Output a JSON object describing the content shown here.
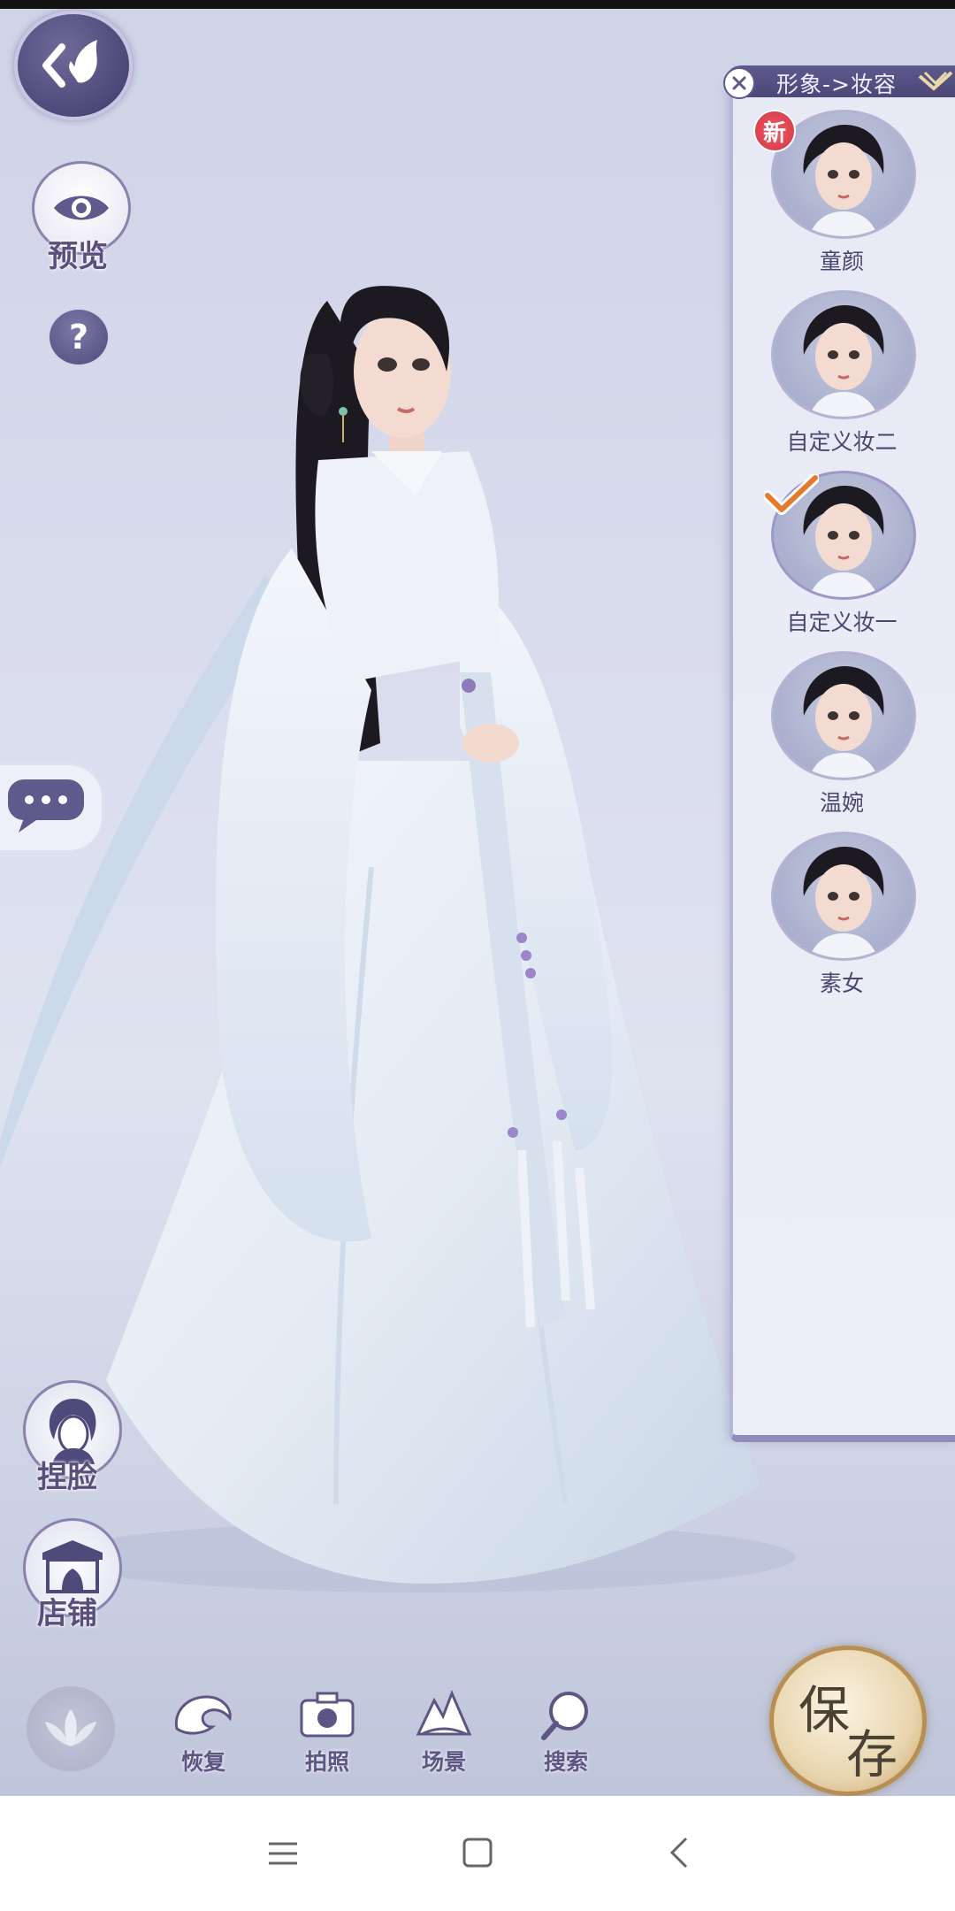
{
  "top": {
    "preview_label": "预览",
    "help_label": "?"
  },
  "panel": {
    "breadcrumb": "形象->妆容",
    "new_badge": "新",
    "looks": [
      {
        "name": "童颜",
        "is_new": true,
        "selected": false
      },
      {
        "name": "自定义妆二",
        "is_new": false,
        "selected": false
      },
      {
        "name": "自定义妆一",
        "is_new": false,
        "selected": true
      },
      {
        "name": "温婉",
        "is_new": false,
        "selected": false
      },
      {
        "name": "素女",
        "is_new": false,
        "selected": false
      }
    ]
  },
  "left_tools": {
    "face_label": "捏脸",
    "shop_label": "店铺"
  },
  "bottom_tools": {
    "restore": "恢复",
    "photo": "拍照",
    "scene": "场景",
    "search": "搜索"
  },
  "save": {
    "line1": "保",
    "line2": "存"
  },
  "colors": {
    "accent": "#5a4f7c",
    "panel_header": "#4b4878",
    "new_badge": "#e0414f",
    "check": "#e57a2c",
    "save_gold": "#c8a36a"
  }
}
